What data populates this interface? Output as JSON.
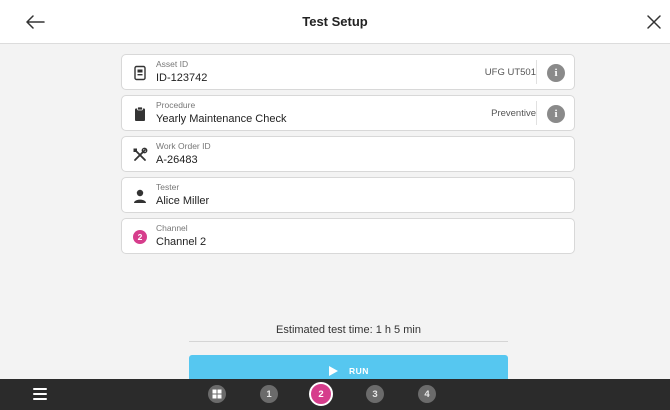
{
  "header": {
    "title": "Test Setup",
    "back_icon": "arrow-left-icon",
    "close_icon": "close-icon"
  },
  "fields": [
    {
      "label": "Asset ID",
      "value": "ID-123742",
      "extra": "UFG UT501",
      "icon": "device-icon",
      "has_info": true
    },
    {
      "label": "Procedure",
      "value": "Yearly Maintenance Check",
      "extra": "Preventive",
      "icon": "clipboard-icon",
      "has_info": true
    },
    {
      "label": "Work Order ID",
      "value": "A-26483",
      "extra": "",
      "icon": "tools-icon",
      "has_info": false
    },
    {
      "label": "Tester",
      "value": "Alice Miller",
      "extra": "",
      "icon": "person-icon",
      "has_info": false
    },
    {
      "label": "Channel",
      "value": "Channel 2",
      "extra": "",
      "icon": "channel-badge",
      "badge": "2",
      "has_info": false
    }
  ],
  "info_glyph": "i",
  "estimate": "Estimated test time: 1 h 5 min",
  "run": {
    "label": "RUN",
    "icon": "play-icon"
  },
  "bottom_nav": {
    "menu_icon": "hamburger-menu-icon",
    "steps": [
      "1",
      "2",
      "3",
      "4"
    ],
    "active_step": "2",
    "home_icon": "grid-icon"
  },
  "colors": {
    "accent": "#56c7f0",
    "active_step": "#d63d8c",
    "bottom_bar": "#2b2b2b",
    "background": "#f3f3f3"
  }
}
